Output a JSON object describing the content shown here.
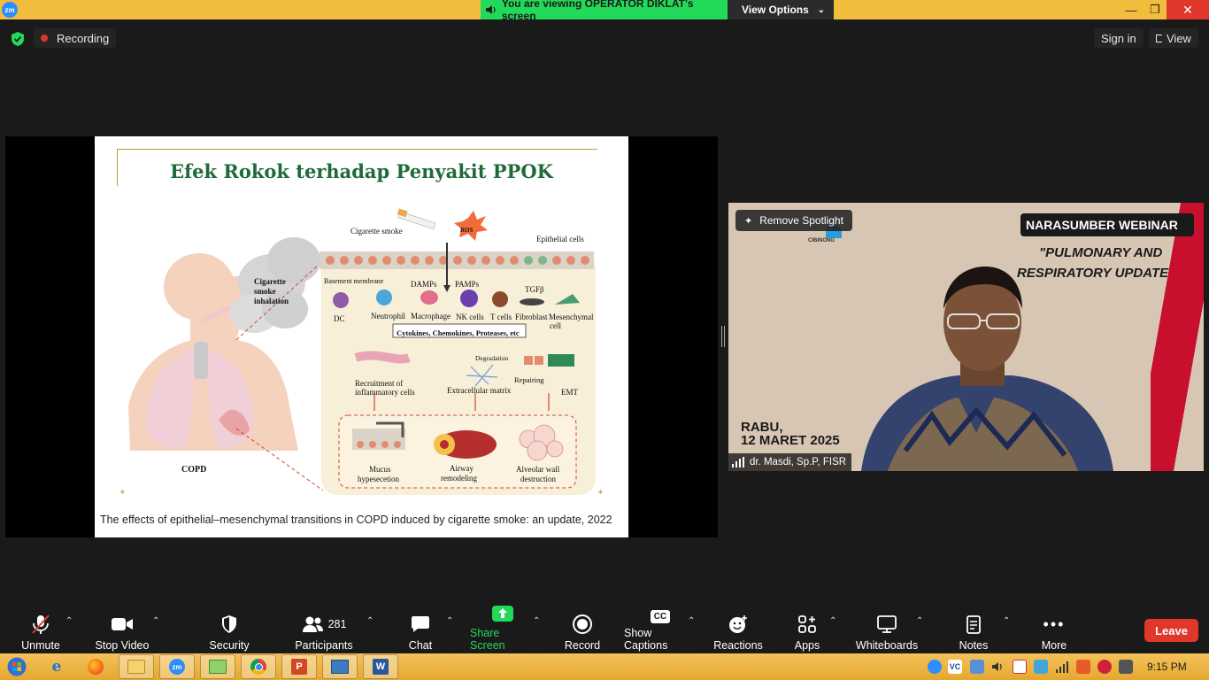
{
  "titlebar": {
    "app_logo": "zm",
    "viewing_text": "You are viewing OPERATOR DIKLAT's screen",
    "view_options_label": "View Options",
    "icons": [
      "zoom-logo-icon",
      "speaker-icon",
      "chevron-down-icon",
      "minimize-icon",
      "restore-icon",
      "close-icon"
    ]
  },
  "topbar": {
    "recording_label": "Recording",
    "signin_label": "Sign in",
    "view_label": "View"
  },
  "slide": {
    "title": "Efek Rokok terhadap Penyakit PPOK",
    "caption": "The effects of epithelial–mesenchymal transitions in COPD induced by cigarette smoke: an update, 2022",
    "labels": {
      "cigarette_smoke": "Cigarette smoke",
      "ros": "ROS",
      "epithelial_cells": "Epithelial cells",
      "smoke_inhalation_1": "Cigarette",
      "smoke_inhalation_2": "smoke",
      "smoke_inhalation_3": "inhalation",
      "basement_membrane": "Basement membrane",
      "damps": "DAMPs",
      "pamps": "PAMPs",
      "tgfb": "TGFβ",
      "dc": "DC",
      "neutrophil": "Neutrophil",
      "macrophage": "Macrophage",
      "nk_cells": "NK cells",
      "t_cells": "T cells",
      "fibroblast": "Fibroblast",
      "mesenchymal": "Mesenchymal",
      "cell": "cell",
      "cytokines": "Cytokines, Chemokines, Proteases, etc",
      "degradation": "Degradation",
      "repairing": "Repairing",
      "recruitment_1": "Recruitment of",
      "recruitment_2": "inflammatory cells",
      "extracellular": "Extracellular matrix",
      "emt": "EMT",
      "copd": "COPD",
      "mucus_1": "Mucus",
      "mucus_2": "hypesecetion",
      "airway_1": "Airway",
      "airway_2": "remodeling",
      "alveolar_1": "Alveolar wall",
      "alveolar_2": "destruction"
    }
  },
  "speaker": {
    "remove_spotlight_label": "Remove Spotlight",
    "banner_title": "NARASUMBER WEBINAR",
    "banner_line1": "\"PULMONARY AND",
    "banner_line2": "RESPIRATORY UPDATE",
    "date_line1": "RABU,",
    "date_line2": "12 MARET 2025",
    "logo_text": "CIBINONG",
    "name": "dr. Masdi, Sp.P, FISR"
  },
  "toolbar": {
    "unmute": "Unmute",
    "stop_video": "Stop Video",
    "security": "Security",
    "participants": "Participants",
    "participants_count": "281",
    "chat": "Chat",
    "share_screen": "Share Screen",
    "record": "Record",
    "show_captions": "Show Captions",
    "reactions": "Reactions",
    "apps": "Apps",
    "whiteboards": "Whiteboards",
    "notes": "Notes",
    "more": "More",
    "leave": "Leave",
    "captions_badge": "CC"
  },
  "taskbar": {
    "clock": "9:15 PM",
    "zoom_app": "zm",
    "powerpoint_letter": "P",
    "word_letter": "W",
    "tray_badge": "VC"
  },
  "colors": {
    "titlebar_bg": "#f2bc3d",
    "viewing_pill": "#23d959",
    "leave": "#e0372b",
    "share_green": "#23d959",
    "slide_title": "#1e6b3a"
  }
}
